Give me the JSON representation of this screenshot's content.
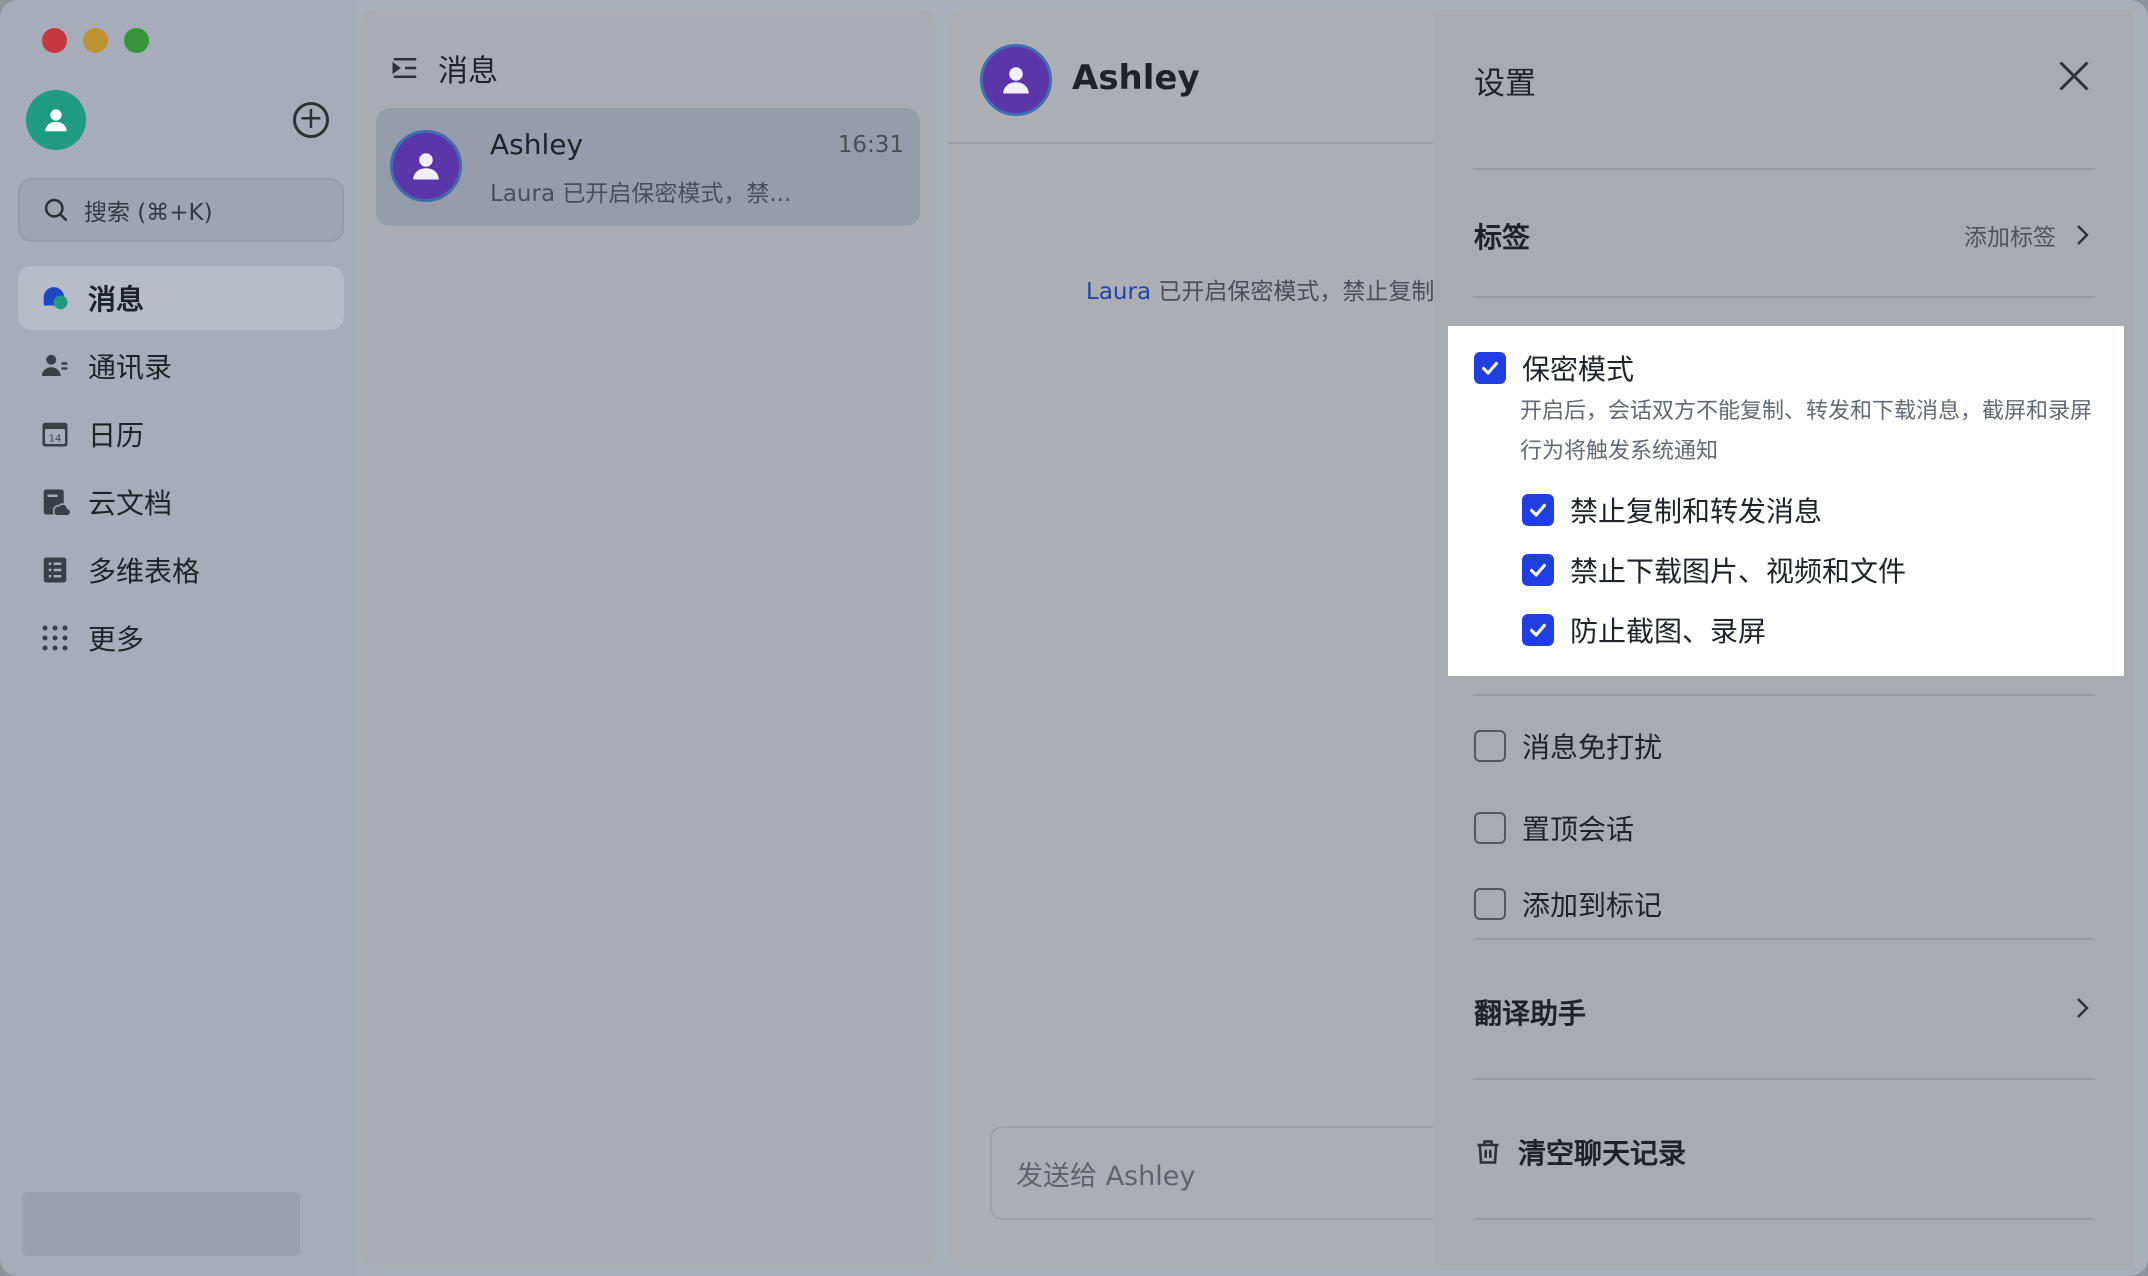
{
  "nav": {
    "search_placeholder": "搜索 (⌘+K)",
    "items": [
      {
        "label": "消息",
        "icon": "chat-bubble-icon",
        "active": true
      },
      {
        "label": "通讯录",
        "icon": "contacts-icon"
      },
      {
        "label": "日历",
        "icon": "calendar-icon",
        "badge": "14"
      },
      {
        "label": "云文档",
        "icon": "cloud-doc-icon"
      },
      {
        "label": "多维表格",
        "icon": "base-table-icon"
      },
      {
        "label": "更多",
        "icon": "grid-dots-icon"
      }
    ]
  },
  "chatlist": {
    "title": "消息",
    "chats": [
      {
        "name": "Ashley",
        "time": "16:31",
        "preview": "Laura 已开启保密模式，禁..."
      }
    ]
  },
  "conversation": {
    "name": "Ashley",
    "system_message_user": "Laura",
    "system_message_text": " 已开启保密模式，禁止复制",
    "input_placeholder": "发送给 Ashley"
  },
  "settings": {
    "title": "设置",
    "tags_label": "标签",
    "add_tag_label": "添加标签",
    "secure_mode": {
      "label": "保密模式",
      "checked": true,
      "description": "开启后，会话双方不能复制、转发和下载消息，截屏和录屏行为将触发系统通知",
      "options": [
        {
          "label": "禁止复制和转发消息",
          "checked": true
        },
        {
          "label": "禁止下载图片、视频和文件",
          "checked": true
        },
        {
          "label": "防止截图、录屏",
          "checked": true
        }
      ]
    },
    "toggles": [
      {
        "label": "消息免打扰",
        "checked": false
      },
      {
        "label": "置顶会话",
        "checked": false
      },
      {
        "label": "添加到标记",
        "checked": false
      }
    ],
    "translate_label": "翻译助手",
    "clear_history_label": "清空聊天记录"
  },
  "colors": {
    "accent": "#1f3fe0",
    "link": "#1f46a8",
    "avatar_me": "#1f9b82",
    "avatar_ashley": "#5a36a8"
  }
}
